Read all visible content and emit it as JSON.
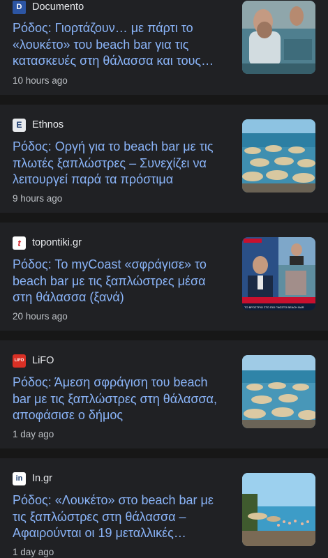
{
  "articles": [
    {
      "source": "Documento",
      "logo_icon": "documento-logo-icon",
      "headline": "Ρόδος: Γιορτάζουν… με πάρτι το «λουκέτο» του beach bar για τις κατασκευές στη θάλασσα και τους…",
      "time": "10 hours ago",
      "thumb_icon": "beach-party-thumbnail"
    },
    {
      "source": "Ethnos",
      "logo_icon": "ethnos-logo-icon",
      "headline": "Ρόδος: Οργή για το beach bar με τις πλωτές ξαπλώστρες – Συνεχίζει να λειτουργεί παρά τα πρόστιμα",
      "time": "9 hours ago",
      "thumb_icon": "beach-umbrellas-thumbnail"
    },
    {
      "source": "topontiki.gr",
      "logo_icon": "topontiki-logo-icon",
      "headline": "Ρόδος: Το myCoast «σφράγισε» το beach bar με τις ξαπλώστρες μέσα στη θάλασσα (ξανά)",
      "time": "20 hours ago",
      "thumb_icon": "tv-news-thumbnail"
    },
    {
      "source": "LiFO",
      "logo_icon": "lifo-logo-icon",
      "headline": "Ρόδος: Άμεση σφράγιση του beach bar με τις ξαπλώστρες στη θάλασσα, αποφάσισε ο δήμος",
      "time": "1 day ago",
      "thumb_icon": "beach-umbrellas-thumbnail"
    },
    {
      "source": "In.gr",
      "logo_icon": "in-gr-logo-icon",
      "headline": "Ρόδος: «Λουκέτο» στο beach bar με τις ξαπλώστρες στη θάλασσα – Αφαιρούνται οι 19 μεταλλικές…",
      "time": "1 day ago",
      "thumb_icon": "beach-sea-thumbnail"
    }
  ],
  "tv_ticker": "ΤΟ ΒΡΟΣΤΡΙΟ ΣΤΟ ΠΙΟ ΓΝΩΣΤΟ BEACH BAR"
}
